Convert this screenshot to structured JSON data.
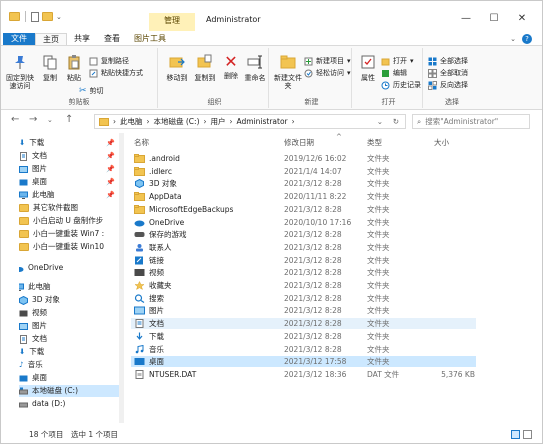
{
  "window": {
    "title": "Administrator",
    "context_tab": "管理",
    "minimize": "—",
    "maximize": "☐",
    "close": "✕",
    "dropdown": "⌄"
  },
  "tabs": [
    "文件",
    "主页",
    "共享",
    "查看",
    "图片工具"
  ],
  "ribbon": {
    "clipboard": {
      "pin": "固定到快速访问",
      "copy": "复制",
      "paste": "粘贴",
      "cut": "剪切",
      "copy_path": "复制路径",
      "paste_shortcut": "粘贴快捷方式",
      "label": "剪贴板"
    },
    "organize": {
      "move_to": "移动到",
      "copy_to": "复制到",
      "delete": "删除",
      "rename": "重命名",
      "label": "组织"
    },
    "new": {
      "new_folder": "新建文件夹",
      "new_item": "新建项目",
      "easy_access": "轻松访问",
      "label": "新建"
    },
    "open": {
      "properties": "属性",
      "open": "打开",
      "edit": "编辑",
      "history": "历史记录",
      "label": "打开"
    },
    "select": {
      "select_all": "全部选择",
      "select_none": "全部取消",
      "invert": "反向选择",
      "label": "选择"
    }
  },
  "address": {
    "path": [
      "此电脑",
      "本地磁盘 (C:)",
      "用户",
      "Administrator"
    ],
    "search_placeholder": "搜索\"Administrator\""
  },
  "nav": [
    {
      "label": "下载",
      "pinned": true,
      "icon": "download-icon"
    },
    {
      "label": "文档",
      "pinned": true,
      "icon": "document-icon"
    },
    {
      "label": "图片",
      "pinned": true,
      "icon": "picture-icon"
    },
    {
      "label": "桌面",
      "pinned": true,
      "icon": "desktop-icon"
    },
    {
      "label": "此电脑",
      "pinned": true,
      "icon": "computer-icon"
    },
    {
      "label": "其它软件截图",
      "pinned": false,
      "icon": "folder-icon"
    },
    {
      "label": "小白启动 U 盘制作步",
      "pinned": false,
      "icon": "folder-icon"
    },
    {
      "label": "小白一键重装 Win7 :",
      "pinned": false,
      "icon": "folder-icon"
    },
    {
      "label": "小白一键重装 Win10",
      "pinned": false,
      "icon": "folder-icon"
    },
    {
      "label": "OneDrive",
      "pinned": false,
      "icon": "cloud-icon"
    },
    {
      "label": "此电脑",
      "pinned": false,
      "icon": "computer-icon"
    },
    {
      "label": "3D 对象",
      "pinned": false,
      "icon": "cube-icon"
    },
    {
      "label": "视频",
      "pinned": false,
      "icon": "video-icon"
    },
    {
      "label": "图片",
      "pinned": false,
      "icon": "picture-icon"
    },
    {
      "label": "文档",
      "pinned": false,
      "icon": "document-icon"
    },
    {
      "label": "下载",
      "pinned": false,
      "icon": "download-icon"
    },
    {
      "label": "音乐",
      "pinned": false,
      "icon": "music-icon"
    },
    {
      "label": "桌面",
      "pinned": false,
      "icon": "desktop-icon"
    },
    {
      "label": "本地磁盘 (C:)",
      "pinned": false,
      "icon": "drive-icon"
    },
    {
      "label": "data (D:)",
      "pinned": false,
      "icon": "drive-icon"
    }
  ],
  "columns": {
    "name": "名称",
    "date": "修改日期",
    "type": "类型",
    "size": "大小"
  },
  "files": [
    {
      "name": ".android",
      "date": "2019/12/6 16:02",
      "type": "文件夹",
      "size": "",
      "icon": "folder-icon"
    },
    {
      "name": ".idlerc",
      "date": "2021/1/4 14:07",
      "type": "文件夹",
      "size": "",
      "icon": "folder-icon"
    },
    {
      "name": "3D 对象",
      "date": "2021/3/12 8:28",
      "type": "文件夹",
      "size": "",
      "icon": "cube-icon"
    },
    {
      "name": "AppData",
      "date": "2020/11/11 8:22",
      "type": "文件夹",
      "size": "",
      "icon": "folder-icon"
    },
    {
      "name": "MicrosoftEdgeBackups",
      "date": "2021/3/12 8:28",
      "type": "文件夹",
      "size": "",
      "icon": "folder-icon"
    },
    {
      "name": "OneDrive",
      "date": "2020/10/10 17:16",
      "type": "文件夹",
      "size": "",
      "icon": "cloud-icon"
    },
    {
      "name": "保存的游戏",
      "date": "2021/3/12 8:28",
      "type": "文件夹",
      "size": "",
      "icon": "game-icon"
    },
    {
      "name": "联系人",
      "date": "2021/3/12 8:28",
      "type": "文件夹",
      "size": "",
      "icon": "contacts-icon"
    },
    {
      "name": "链接",
      "date": "2021/3/12 8:28",
      "type": "文件夹",
      "size": "",
      "icon": "link-icon"
    },
    {
      "name": "视频",
      "date": "2021/3/12 8:28",
      "type": "文件夹",
      "size": "",
      "icon": "video-icon"
    },
    {
      "name": "收藏夹",
      "date": "2021/3/12 8:28",
      "type": "文件夹",
      "size": "",
      "icon": "star-icon"
    },
    {
      "name": "搜索",
      "date": "2021/3/12 8:28",
      "type": "文件夹",
      "size": "",
      "icon": "search-icon"
    },
    {
      "name": "图片",
      "date": "2021/3/12 8:28",
      "type": "文件夹",
      "size": "",
      "icon": "picture-icon"
    },
    {
      "name": "文档",
      "date": "2021/3/12 8:28",
      "type": "文件夹",
      "size": "",
      "icon": "document-icon"
    },
    {
      "name": "下载",
      "date": "2021/3/12 8:28",
      "type": "文件夹",
      "size": "",
      "icon": "download-icon"
    },
    {
      "name": "音乐",
      "date": "2021/3/12 8:28",
      "type": "文件夹",
      "size": "",
      "icon": "music-icon"
    },
    {
      "name": "桌面",
      "date": "2021/3/12 17:58",
      "type": "文件夹",
      "size": "",
      "icon": "desktop-icon"
    },
    {
      "name": "NTUSER.DAT",
      "date": "2021/3/12 18:36",
      "type": "DAT 文件",
      "size": "5,376 KB",
      "icon": "file-icon"
    }
  ],
  "status": {
    "count": "18 个项目",
    "selected": "选中 1 个项目"
  },
  "colors": {
    "accent": "#1979ca",
    "folder": "#f2c451",
    "selection": "#cce8ff",
    "hover": "#e5f1fb"
  }
}
